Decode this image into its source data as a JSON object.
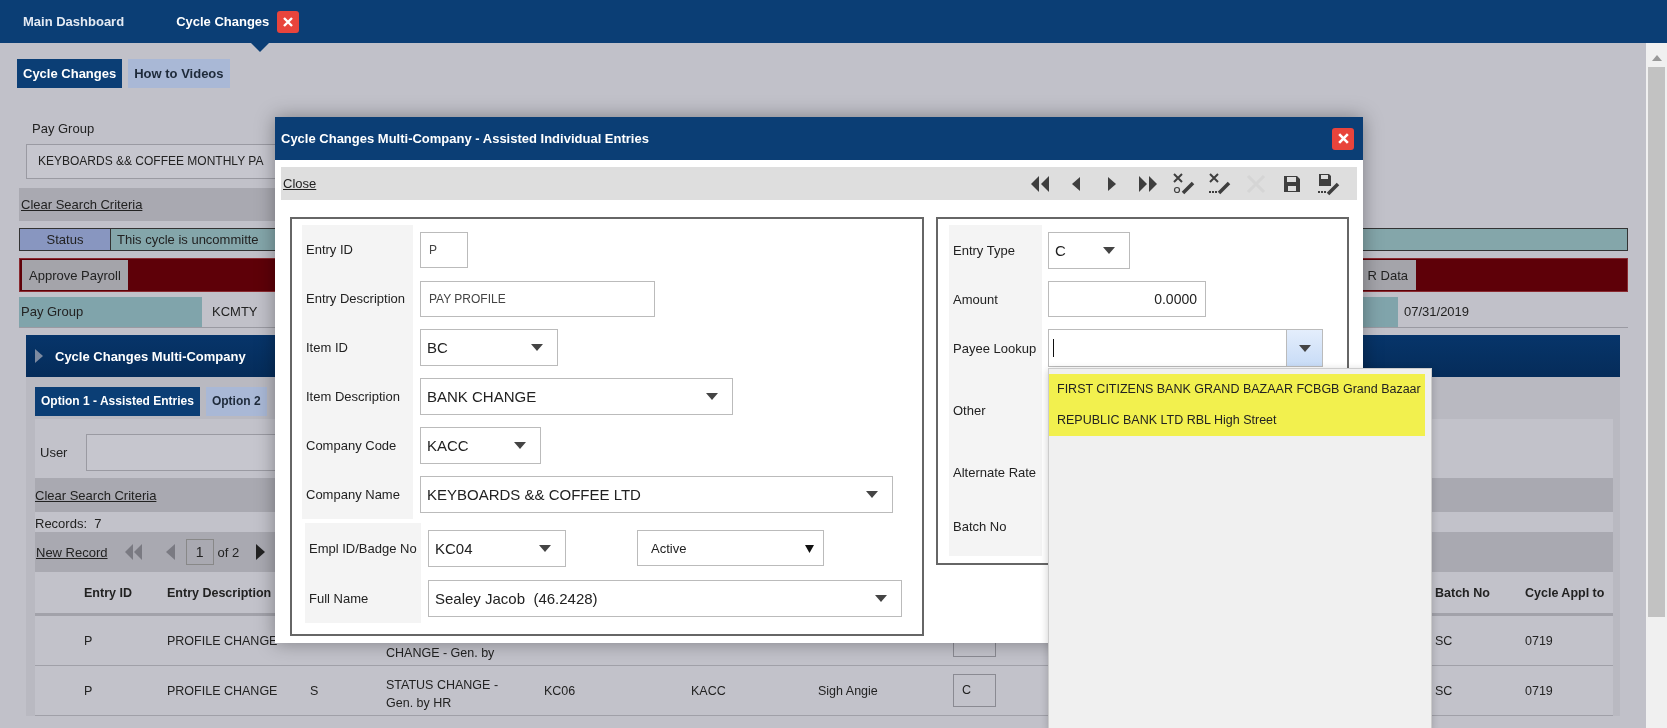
{
  "nav_tabs": [
    {
      "label": "Main Dashboard",
      "selected": false,
      "closable": false
    },
    {
      "label": "Cycle Changes",
      "selected": true,
      "closable": true
    }
  ],
  "page_tabs": [
    {
      "label": "Cycle Changes",
      "selected": true
    },
    {
      "label": "How to Videos",
      "selected": false
    }
  ],
  "pay_group": {
    "label": "Pay Group",
    "value": "KEYBOARDS && COFFEE MONTHLY PA"
  },
  "clear_search": "Clear Search Criteria",
  "status": {
    "label": "Status",
    "text": "This cycle is uncommitte"
  },
  "approve_bar": {
    "buttons": [
      "Approve Payroll",
      "R Data"
    ]
  },
  "summary_row": {
    "label": "Pay Group",
    "value": "KCMTY",
    "date": "07/31/2019"
  },
  "panel": {
    "title": "Cycle Changes Multi-Company",
    "option_tabs": [
      {
        "label": "Option 1 - Assisted Entries",
        "selected": true
      },
      {
        "label": "Option 2",
        "selected": false
      }
    ],
    "user_filter": {
      "label": "User"
    },
    "clear_search": "Clear Search Criteria",
    "records": "Records:  7",
    "pager": {
      "new_record": "New Record",
      "page": "1",
      "page_count": "of 2"
    },
    "table": {
      "columns": [
        "Entry ID",
        "Entry Description",
        "Batch No",
        "Cycle Appl to"
      ],
      "rows": [
        {
          "entry_id": "P",
          "entry_description": "PROFILE CHANGE",
          "column_4": "CHANGE - Gen. by",
          "batch_no": "SC",
          "cycle_appl_to": "0719"
        },
        {
          "entry_id": "P",
          "entry_description": "PROFILE CHANGE",
          "column_3": "S",
          "column_4": "STATUS CHANGE - Gen. by HR",
          "column_5": "KC06",
          "column_6": "KACC",
          "column_7": "Sigh Angie",
          "column_8": "C",
          "batch_no": "SC",
          "cycle_appl_to": "0719"
        }
      ]
    }
  },
  "modal": {
    "title": "Cycle Changes Multi-Company - Assisted Individual Entries",
    "close_link": "Close",
    "toolbar": [
      {
        "kind": "first",
        "disabled": false
      },
      {
        "kind": "prev",
        "disabled": false
      },
      {
        "kind": "next",
        "disabled": false
      },
      {
        "kind": "last",
        "disabled": false
      },
      {
        "kind": "clear_new",
        "disabled": false
      },
      {
        "kind": "clear",
        "disabled": false
      },
      {
        "kind": "delete",
        "disabled": true
      },
      {
        "kind": "save",
        "disabled": false
      },
      {
        "kind": "save_edit",
        "disabled": false
      }
    ],
    "entry_fields": [
      {
        "label": "Entry ID",
        "kind": "text",
        "value": "P"
      },
      {
        "label": "Entry Description",
        "kind": "text",
        "value": "PAY PROFILE"
      },
      {
        "label": "Item ID",
        "kind": "select",
        "value": "BC"
      },
      {
        "label": "Item Description",
        "kind": "select",
        "value": "BANK CHANGE"
      },
      {
        "label": "Company Code",
        "kind": "select",
        "value": "KACC"
      },
      {
        "label": "Company Name",
        "kind": "select",
        "value": "KEYBOARDS && COFFEE LTD"
      }
    ],
    "employee": {
      "badge": {
        "label": "Empl ID/Badge No",
        "value": "KC04"
      },
      "status": {
        "value": "Active"
      },
      "name": {
        "label": "Full Name",
        "value": "Sealey Jacob  (46.2428)"
      }
    },
    "amount_fields": [
      {
        "label": "Entry Type",
        "kind": "select",
        "value": "C"
      },
      {
        "label": "Amount",
        "kind": "number",
        "value": "0.0000"
      },
      {
        "label": "Payee Lookup",
        "kind": "combo",
        "focused": true,
        "expanded": true,
        "options": [
          "FIRST CITIZENS BANK GRAND BAZAAR FCBGB Grand Bazaar",
          "REPUBLIC BANK LTD RBL High Street"
        ]
      },
      {
        "label": "Other",
        "kind": "covered"
      },
      {
        "label": "Alternate Rate",
        "kind": "covered"
      },
      {
        "label": "Batch No",
        "kind": "covered"
      }
    ]
  }
}
